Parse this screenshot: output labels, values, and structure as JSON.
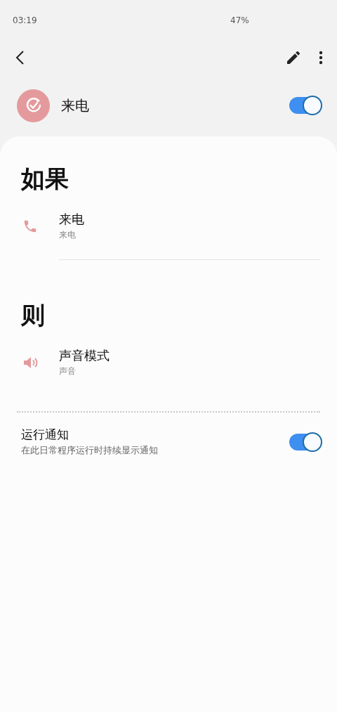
{
  "status_bar": {
    "time": "03:19",
    "battery": "47%"
  },
  "routine": {
    "title": "来电",
    "on": true
  },
  "sections": [
    {
      "heading": "如果",
      "items": [
        {
          "kind": "call",
          "title": "来电",
          "subtitle": "来电"
        }
      ]
    },
    {
      "heading": "则",
      "items": [
        {
          "kind": "sound",
          "title": "声音模式",
          "subtitle": "声音"
        }
      ]
    }
  ],
  "notification": {
    "title": "运行通知",
    "description": "在此日常程序运行时持续显示通知",
    "on": true
  }
}
